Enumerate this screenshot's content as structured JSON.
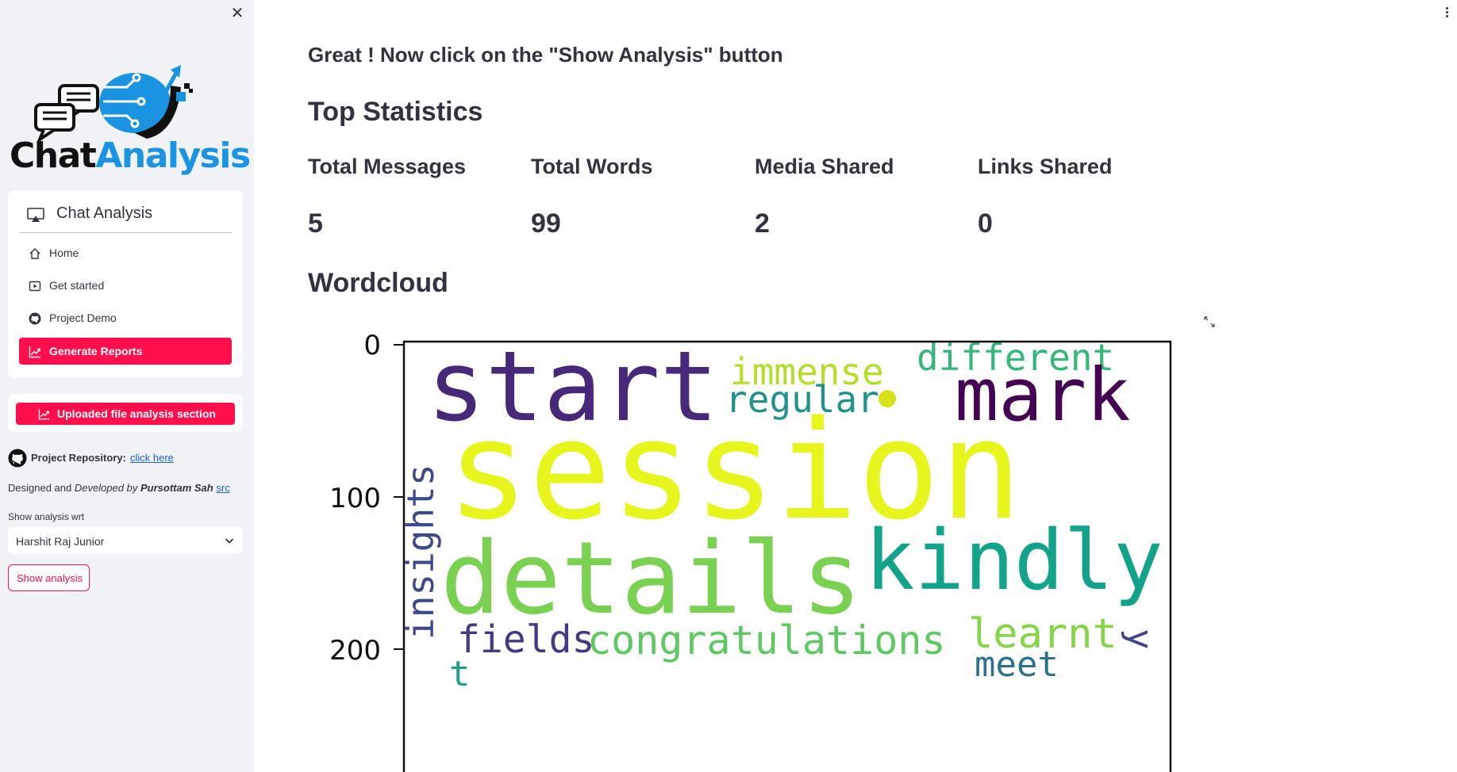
{
  "sidebar": {
    "logo": {
      "text_part1": "Chat",
      "text_part2": "Analysis"
    },
    "menu": {
      "title": "Chat Analysis",
      "items": [
        {
          "label": "Home",
          "icon": "house-icon",
          "active": false
        },
        {
          "label": "Get started",
          "icon": "play-square-icon",
          "active": false
        },
        {
          "label": "Project Demo",
          "icon": "github-icon",
          "active": false
        },
        {
          "label": "Generate Reports",
          "icon": "graph-up-icon",
          "active": true
        }
      ]
    },
    "upload_button": {
      "label": "Uploaded file analysis section",
      "icon": "graph-up-icon"
    },
    "repository": {
      "label": "Project Repository:",
      "link_text": "click here"
    },
    "credit": {
      "designed": "Designed and",
      "developed": "Developed by",
      "author": "Pursottam Sah",
      "src_link": "src"
    },
    "select": {
      "label": "Show analysis wrt",
      "value": "Harshit Raj Junior"
    },
    "show_button": {
      "label": "Show analysis"
    }
  },
  "main": {
    "instruction": "Great ! Now click on the \"Show Analysis\" button",
    "top_statistics_title": "Top Statistics",
    "stats": [
      {
        "label": "Total Messages",
        "value": "5"
      },
      {
        "label": "Total Words",
        "value": "99"
      },
      {
        "label": "Media Shared",
        "value": "2"
      },
      {
        "label": "Links Shared",
        "value": "0"
      }
    ],
    "wordcloud_title": "Wordcloud",
    "wordcloud": {
      "y_ticks": [
        "0",
        "100",
        "200"
      ],
      "words": [
        {
          "text": "start",
          "color": "#482878"
        },
        {
          "text": "immense",
          "color": "#b5de2b"
        },
        {
          "text": "different",
          "color": "#35b779"
        },
        {
          "text": "mark",
          "color": "#440154"
        },
        {
          "text": "regular",
          "color": "#21918c"
        },
        {
          "text": "session",
          "color": "#e7f51d"
        },
        {
          "text": "insights",
          "color": "#3e4989"
        },
        {
          "text": "details",
          "color": "#7ad151"
        },
        {
          "text": "kindly",
          "color": "#13a38a"
        },
        {
          "text": "fields",
          "color": "#443a83"
        },
        {
          "text": "congratulations",
          "color": "#5ec962"
        },
        {
          "text": "learnt",
          "color": "#86d549"
        },
        {
          "text": "y",
          "color": "#414487"
        },
        {
          "text": "meet",
          "color": "#2c728e"
        },
        {
          "text": "t",
          "color": "#1fa187"
        }
      ],
      "colors": {
        "dot": "#d8e219"
      }
    }
  },
  "colors": {
    "accent": "#ff0f4b",
    "sidebar_bg": "#f0f2f6",
    "text": "#31333f",
    "link": "#1a5fd4",
    "logo_blue": "#1a93e0"
  }
}
